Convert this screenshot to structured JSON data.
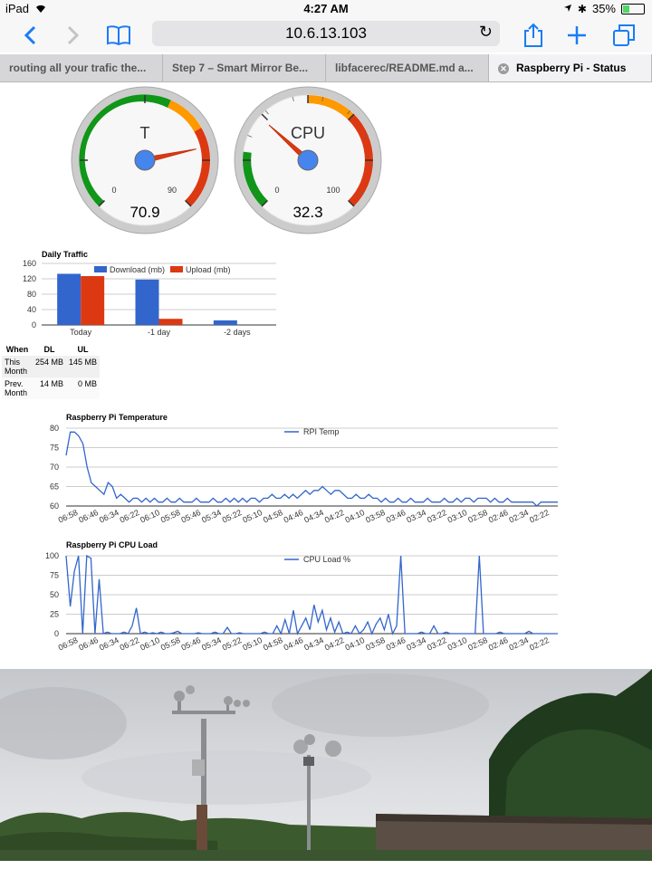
{
  "status": {
    "carrier": "iPad",
    "time": "4:27 AM",
    "battery": "35%"
  },
  "browser": {
    "url": "10.6.13.103"
  },
  "tabs": [
    {
      "label": "routing all your trafic the..."
    },
    {
      "label": "Step 7 – Smart Mirror Be..."
    },
    {
      "label": "libfacerec/README.md a..."
    },
    {
      "label": "Raspberry Pi - Status"
    }
  ],
  "gauges": [
    {
      "label": "T",
      "value": 70.9,
      "min": "0",
      "max": "90",
      "display": "70.9"
    },
    {
      "label": "CPU",
      "value": 32.3,
      "min": "0",
      "max": "100",
      "display": "32.3"
    }
  ],
  "colors": {
    "green": "#109618",
    "orange": "#ff9900",
    "red": "#dc3912",
    "blue": "#3366cc",
    "accent": "#1a7cf7"
  },
  "traffic_table": {
    "headers": [
      "When",
      "DL",
      "UL"
    ],
    "rows": [
      {
        "when": "This Month",
        "dl": "254 MB",
        "ul": "145 MB"
      },
      {
        "when": "Prev. Month",
        "dl": "14 MB",
        "ul": "0 MB"
      }
    ]
  },
  "chart_data": [
    {
      "type": "bar",
      "title": "Daily Traffic",
      "categories": [
        "Today",
        "-1 day",
        "-2 days"
      ],
      "series": [
        {
          "name": "Download (mb)",
          "values": [
            133,
            118,
            12
          ]
        },
        {
          "name": "Upload (mb)",
          "values": [
            127,
            16,
            0
          ]
        }
      ],
      "ylim": [
        0,
        160
      ],
      "yticks": [
        "0",
        "40",
        "80",
        "120",
        "160"
      ],
      "grid": true,
      "legend": "top"
    },
    {
      "type": "line",
      "title": "Raspberry Pi Temperature",
      "series": [
        {
          "name": "RPI Temp",
          "values": [
            73,
            79,
            79,
            78,
            76,
            70,
            66,
            65,
            64,
            63,
            66,
            65,
            62,
            63,
            62,
            61,
            62,
            62,
            61,
            62,
            61,
            62,
            61,
            61,
            62,
            61,
            61,
            62,
            61,
            61,
            61,
            62,
            61,
            61,
            61,
            62,
            61,
            61,
            62,
            61,
            62,
            61,
            62,
            61,
            62,
            62,
            61,
            62,
            62,
            63,
            62,
            62,
            63,
            62,
            63,
            62,
            63,
            64,
            63,
            64,
            64,
            65,
            64,
            63,
            64,
            64,
            63,
            62,
            62,
            63,
            62,
            62,
            63,
            62,
            62,
            61,
            62,
            61,
            61,
            62,
            61,
            61,
            62,
            61,
            61,
            61,
            62,
            61,
            61,
            61,
            62,
            61,
            61,
            62,
            61,
            62,
            62,
            61,
            62,
            62,
            62,
            61,
            62,
            61,
            61,
            62,
            61,
            61,
            61,
            61,
            61,
            61,
            60,
            61,
            61,
            61,
            61,
            61
          ]
        }
      ],
      "x_labels": [
        "06:58",
        "06:46",
        "06:34",
        "06:22",
        "06:10",
        "05:58",
        "05:46",
        "05:34",
        "05:22",
        "05:10",
        "04:58",
        "04:46",
        "04:34",
        "04:22",
        "04:10",
        "03:58",
        "03:46",
        "03:34",
        "03:22",
        "03:10",
        "02:58",
        "02:46",
        "02:34",
        "02:22"
      ],
      "ylim": [
        60,
        80
      ],
      "yticks": [
        "60",
        "65",
        "70",
        "75",
        "80"
      ],
      "grid": true,
      "legend": "top"
    },
    {
      "type": "line",
      "title": "Raspberry Pi CPU Load",
      "series": [
        {
          "name": "CPU Load %",
          "values": [
            100,
            35,
            80,
            100,
            0,
            100,
            97,
            0,
            70,
            0,
            2,
            0,
            0,
            0,
            2,
            0,
            10,
            33,
            0,
            2,
            0,
            1,
            0,
            2,
            0,
            0,
            1,
            3,
            0,
            0,
            0,
            0,
            1,
            0,
            0,
            0,
            2,
            0,
            0,
            8,
            0,
            0,
            1,
            0,
            0,
            0,
            0,
            0,
            2,
            0,
            0,
            10,
            0,
            18,
            0,
            30,
            0,
            10,
            20,
            5,
            37,
            15,
            30,
            5,
            20,
            2,
            15,
            0,
            2,
            0,
            10,
            0,
            5,
            15,
            0,
            12,
            20,
            5,
            25,
            0,
            10,
            100,
            0,
            0,
            0,
            0,
            2,
            0,
            0,
            10,
            0,
            0,
            2,
            0,
            0,
            0,
            0,
            0,
            0,
            0,
            100,
            0,
            0,
            0,
            0,
            2,
            0,
            0,
            0,
            0,
            0,
            0,
            3,
            0,
            0,
            0,
            0,
            0,
            0,
            0
          ]
        }
      ],
      "x_labels": [
        "06:58",
        "06:46",
        "06:34",
        "06:22",
        "06:10",
        "05:58",
        "05:46",
        "05:34",
        "05:22",
        "05:10",
        "04:58",
        "04:46",
        "04:34",
        "04:22",
        "04:10",
        "03:58",
        "03:46",
        "03:34",
        "03:22",
        "03:10",
        "02:58",
        "02:46",
        "02:34",
        "02:22"
      ],
      "ylim": [
        0,
        100
      ],
      "yticks": [
        "0",
        "25",
        "50",
        "75",
        "100"
      ],
      "grid": true,
      "legend": "top"
    }
  ]
}
